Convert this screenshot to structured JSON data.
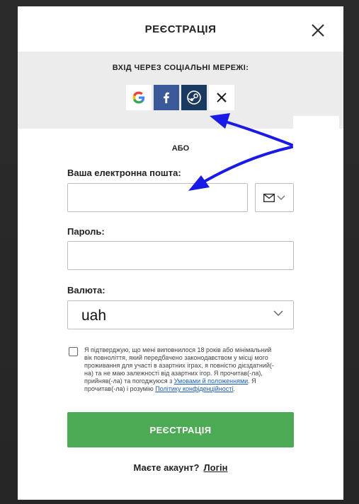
{
  "modal": {
    "title": "РЕЄСТРАЦІЯ",
    "close_icon": "close-icon"
  },
  "social": {
    "title": "ВХІД ЧЕРЕЗ СОЦІАЛЬНІ МЕРЕЖІ:",
    "providers": [
      {
        "name": "google",
        "icon": "google-icon"
      },
      {
        "name": "facebook",
        "icon": "facebook-icon"
      },
      {
        "name": "steam",
        "icon": "steam-icon"
      },
      {
        "name": "x",
        "icon": "x-icon"
      }
    ]
  },
  "or_text": "АБО",
  "form": {
    "email_label": "Ваша електронна пошта:",
    "email_value": "",
    "email_type_icon": "envelope-icon",
    "password_label": "Пароль:",
    "password_value": "",
    "currency_label": "Валюта:",
    "currency_value": "uah",
    "terms_text_1": "Я підтверджую, що мені виповнилося 18 років або мінімальний вік повноліття, який передбачено законодавством у місці мого проживання для участі в азартних іграх, я повністю дієздатний(-на) та не маю залежності від азартних ігор. Я прочитав(-ла), прийняв(-ла) та погоджуюся з ",
    "terms_link": "Умовами й положеннями",
    "terms_text_2": ". Я прочитав(-ла) і розумію ",
    "privacy_link": "Політику конфіденційності",
    "terms_text_3": ".",
    "submit_label": "РЕЄСТРАЦІЯ"
  },
  "login": {
    "prompt": "Маєте акаунт?",
    "link": "Логін"
  },
  "colors": {
    "accent_green": "#4caa55",
    "annotation_arrow": "#1a1ae6",
    "facebook": "#3b5998",
    "steam": "#1b3a5f"
  }
}
